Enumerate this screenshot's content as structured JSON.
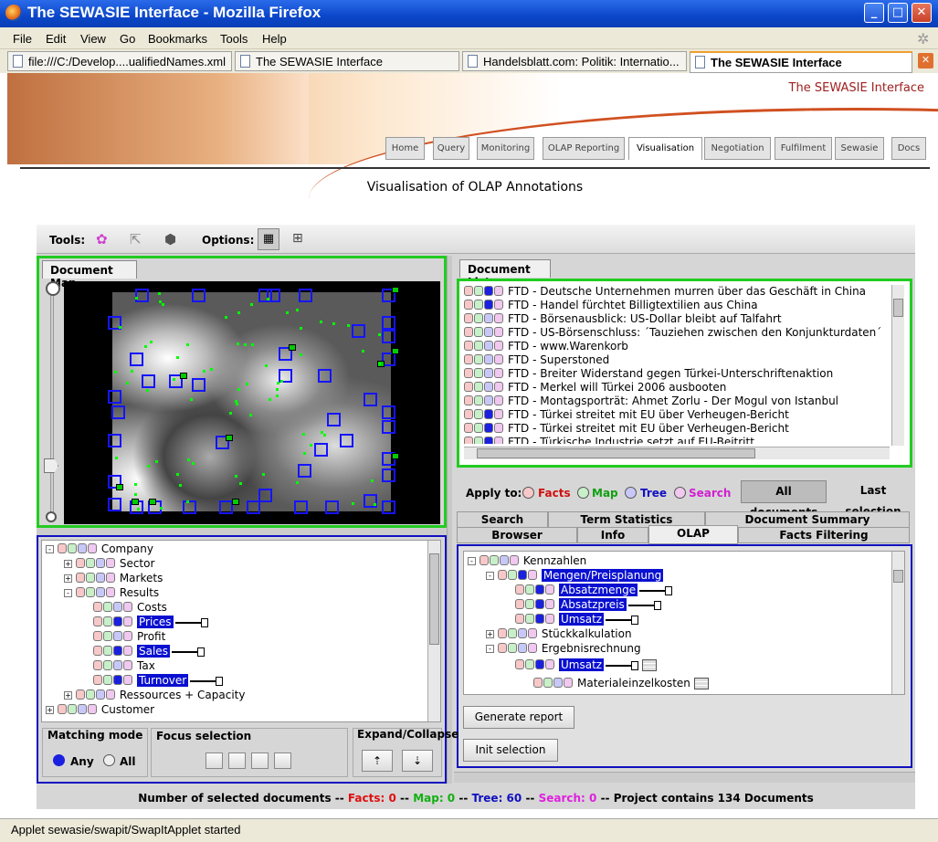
{
  "window": {
    "title": "The SEWASIE Interface - Mozilla Firefox"
  },
  "menu": [
    "File",
    "Edit",
    "View",
    "Go",
    "Bookmarks",
    "Tools",
    "Help"
  ],
  "browser_tabs": [
    {
      "label": "file:///C:/Develop....ualifiedNames.xml"
    },
    {
      "label": "The SEWASIE Interface"
    },
    {
      "label": "Handelsblatt.com: Politik: Internatio..."
    },
    {
      "label": "The SEWASIE Interface"
    }
  ],
  "site": {
    "brand": "The SEWASIE Interface",
    "nav": [
      "Home",
      "Query",
      "Monitoring",
      "OLAP Reporting",
      "Visualisation",
      "Negotiation",
      "Fulfilment",
      "Sewasie",
      "Docs"
    ],
    "page_title": "Visualisation of OLAP Annotations"
  },
  "tools": {
    "tools_label": "Tools:",
    "options_label": "Options:"
  },
  "map": {
    "tab": "Document Map"
  },
  "doclist": {
    "tab": "Document List",
    "items": [
      "FTD - Deutsche Unternehmen murren über das Geschäft in China",
      "FTD - Handel fürchtet Billigtextilien aus China",
      "FTD - Börsenausblick: US-Dollar bleibt auf Talfahrt",
      "FTD - US-Börsenschluss: ´Tauziehen zwischen den Konjunkturdaten´",
      "FTD - www.Warenkorb",
      "FTD - Superstoned",
      "FTD - Breiter Widerstand gegen Türkei-Unterschriftenaktion",
      "FTD - Merkel will Türkei 2006 ausbooten",
      "FTD - Montagsporträt: Ahmet Zorlu - Der Mogul von Istanbul",
      "FTD - Türkei streitet mit EU über Verheugen-Bericht",
      "FTD - Türkei streitet mit EU über Verheugen-Bericht",
      "FTD - Türkische Industrie setzt auf EU-Beitritt"
    ]
  },
  "apply": {
    "label": "Apply to:",
    "facts": "Facts",
    "map": "Map",
    "tree": "Tree",
    "search": "Search",
    "all": "All documents",
    "last": "Last selection"
  },
  "ptabs": {
    "search": "Search",
    "termstats": "Term Statistics",
    "docsummary": "Document Summary",
    "browser": "Browser",
    "info": "Info",
    "olap": "OLAP",
    "factsfilter": "Facts Filtering"
  },
  "left_tree": [
    "Company",
    "Sector",
    "Markets",
    "Results",
    "Costs",
    "Prices",
    "Profit",
    "Sales",
    "Tax",
    "Turnover",
    "Ressources + Capacity",
    "Customer"
  ],
  "olap_tree": [
    "Kennzahlen",
    "Mengen/Preisplanung",
    "Absatzmenge",
    "Absatzpreis",
    "Umsatz",
    "Stückkalkulation",
    "Ergebnisrechnung",
    "Umsatz",
    "Materialeinzelkosten"
  ],
  "buttons": {
    "generate": "Generate report",
    "init": "Init selection"
  },
  "controls": {
    "matching": "Matching mode",
    "any": "Any",
    "all": "All",
    "focus": "Focus selection",
    "expand": "Expand/Collapse"
  },
  "summary": {
    "prefix": "Number of selected documents --",
    "facts": "Facts: 0",
    "sep1": "--",
    "map": "Map: 0",
    "sep2": "--",
    "tree": "Tree: 60",
    "sep3": "--",
    "search": "Search: 0",
    "suffix": "-- Project contains 134 Documents"
  },
  "status": "Applet sewasie/swapit/SwapItApplet started"
}
